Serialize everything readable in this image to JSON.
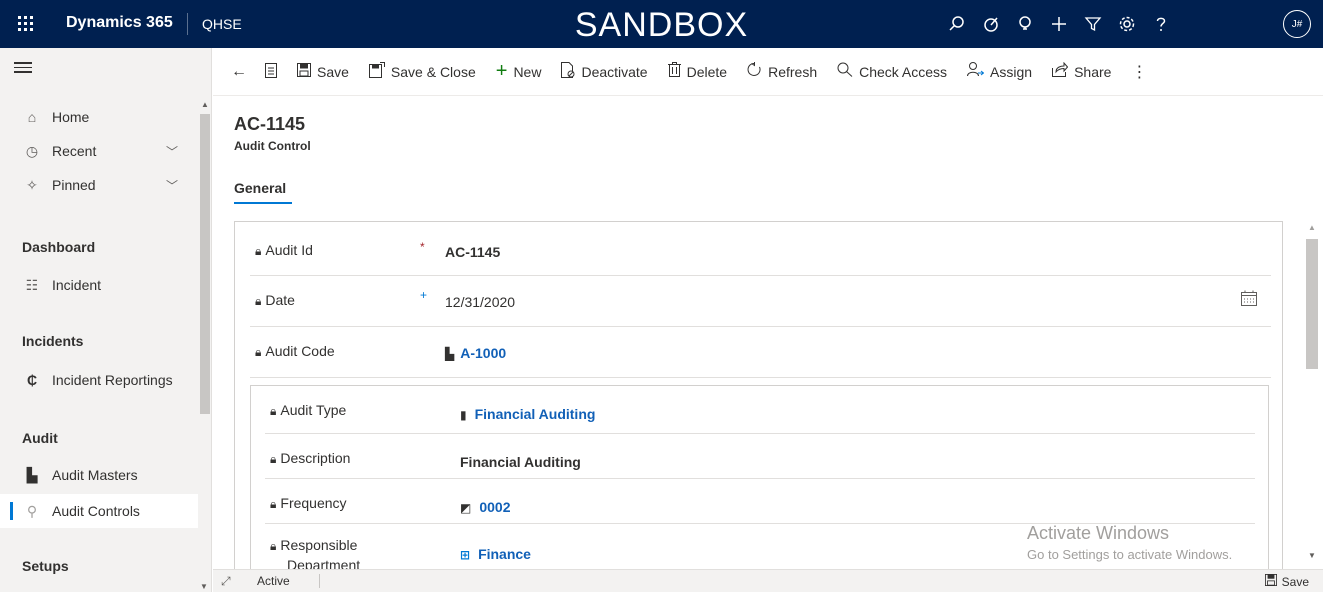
{
  "topbar": {
    "app_name": "Dynamics 365",
    "area_name": "QHSE",
    "environment_banner": "SANDBOX",
    "avatar_initials": "J#",
    "bg_color": "#002050"
  },
  "sidebar": {
    "home": "Home",
    "recent": "Recent",
    "pinned": "Pinned",
    "groups": {
      "dashboard": "Dashboard",
      "incidents": "Incidents",
      "audit": "Audit",
      "setups": "Setups"
    },
    "items": {
      "incident": "Incident",
      "incident_reportings": "Incident Reportings",
      "audit_masters": "Audit Masters",
      "audit_controls": "Audit Controls"
    }
  },
  "commandbar": {
    "save": "Save",
    "save_close": "Save & Close",
    "new": "New",
    "deactivate": "Deactivate",
    "delete": "Delete",
    "refresh": "Refresh",
    "check_access": "Check Access",
    "assign": "Assign",
    "share": "Share"
  },
  "header": {
    "record_title": "AC-1145",
    "entity_name": "Audit Control",
    "tab": "General"
  },
  "form": {
    "audit_id": {
      "label": "Audit Id",
      "required_marker": "*",
      "value": "AC-1145"
    },
    "date": {
      "label": "Date",
      "recommended_marker": "+",
      "value": "12/31/2020"
    },
    "audit_code": {
      "label": "Audit Code",
      "value": "A-1000"
    },
    "audit_type": {
      "label": "Audit Type",
      "value": "Financial Auditing"
    },
    "description": {
      "label": "Description",
      "value": "Financial Auditing"
    },
    "frequency": {
      "label": "Frequency",
      "value": "0002"
    },
    "responsible_department": {
      "label_line1": "Responsible",
      "label_line2": "Department",
      "value": "Finance"
    }
  },
  "watermark": {
    "line1": "Activate Windows",
    "line2": "Go to Settings to activate Windows."
  },
  "statusbar": {
    "status": "Active",
    "save": "Save"
  },
  "colors": {
    "accent": "#0078d4",
    "link": "#1160b7",
    "required": "#a4262c",
    "new_icon": "#107c10"
  }
}
